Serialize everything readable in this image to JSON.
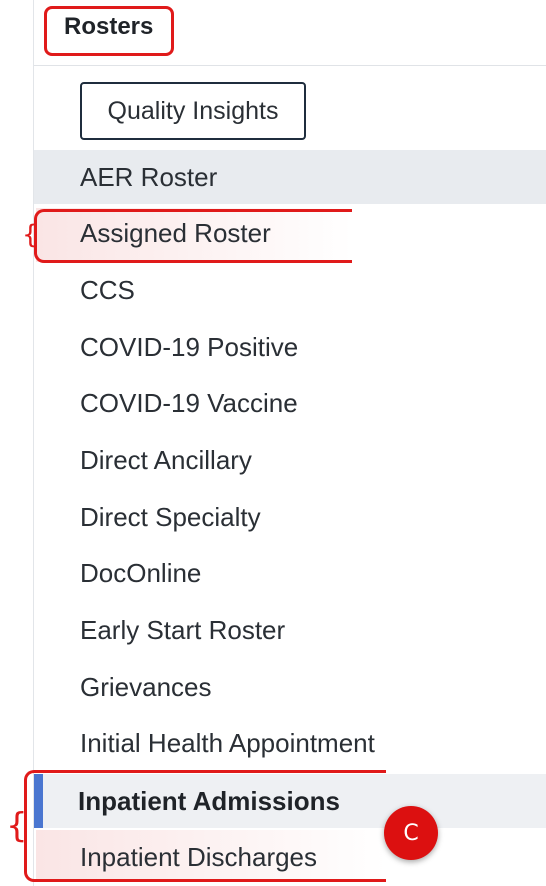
{
  "section": {
    "title": "Rosters",
    "collapse_icon": "chevron-up-icon"
  },
  "quality_insights_button": "Quality Insights",
  "items": [
    {
      "label": "AER Roster"
    },
    {
      "label": "Assigned Roster"
    },
    {
      "label": "CCS"
    },
    {
      "label": "COVID-19 Positive"
    },
    {
      "label": "COVID-19 Vaccine"
    },
    {
      "label": "Direct Ancillary"
    },
    {
      "label": "Direct Specialty"
    },
    {
      "label": "DocOnline"
    },
    {
      "label": "Early Start Roster"
    },
    {
      "label": "Grievances"
    },
    {
      "label": "Initial Health Appointment"
    },
    {
      "label": "Inpatient Admissions"
    },
    {
      "label": "Inpatient Discharges"
    }
  ],
  "marker": {
    "label": "C"
  },
  "colors": {
    "annotation_red": "#e01a1a",
    "active_bar": "#4a76d0",
    "hover_row": "#e8ebef"
  }
}
